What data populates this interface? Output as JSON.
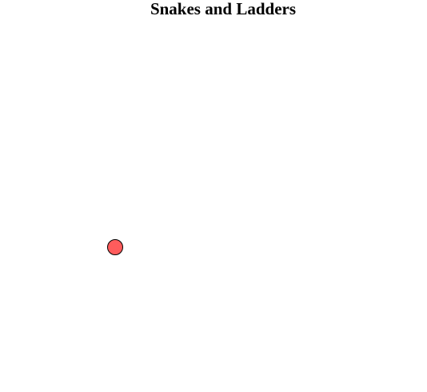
{
  "game": {
    "title": "Snakes and Ladders"
  },
  "player": {
    "token_color": "#ff5c5c",
    "token_icon": "player-token-circle"
  },
  "colors": {
    "background": "#ffffff",
    "title_text": "#000000",
    "token_border": "#000000"
  }
}
